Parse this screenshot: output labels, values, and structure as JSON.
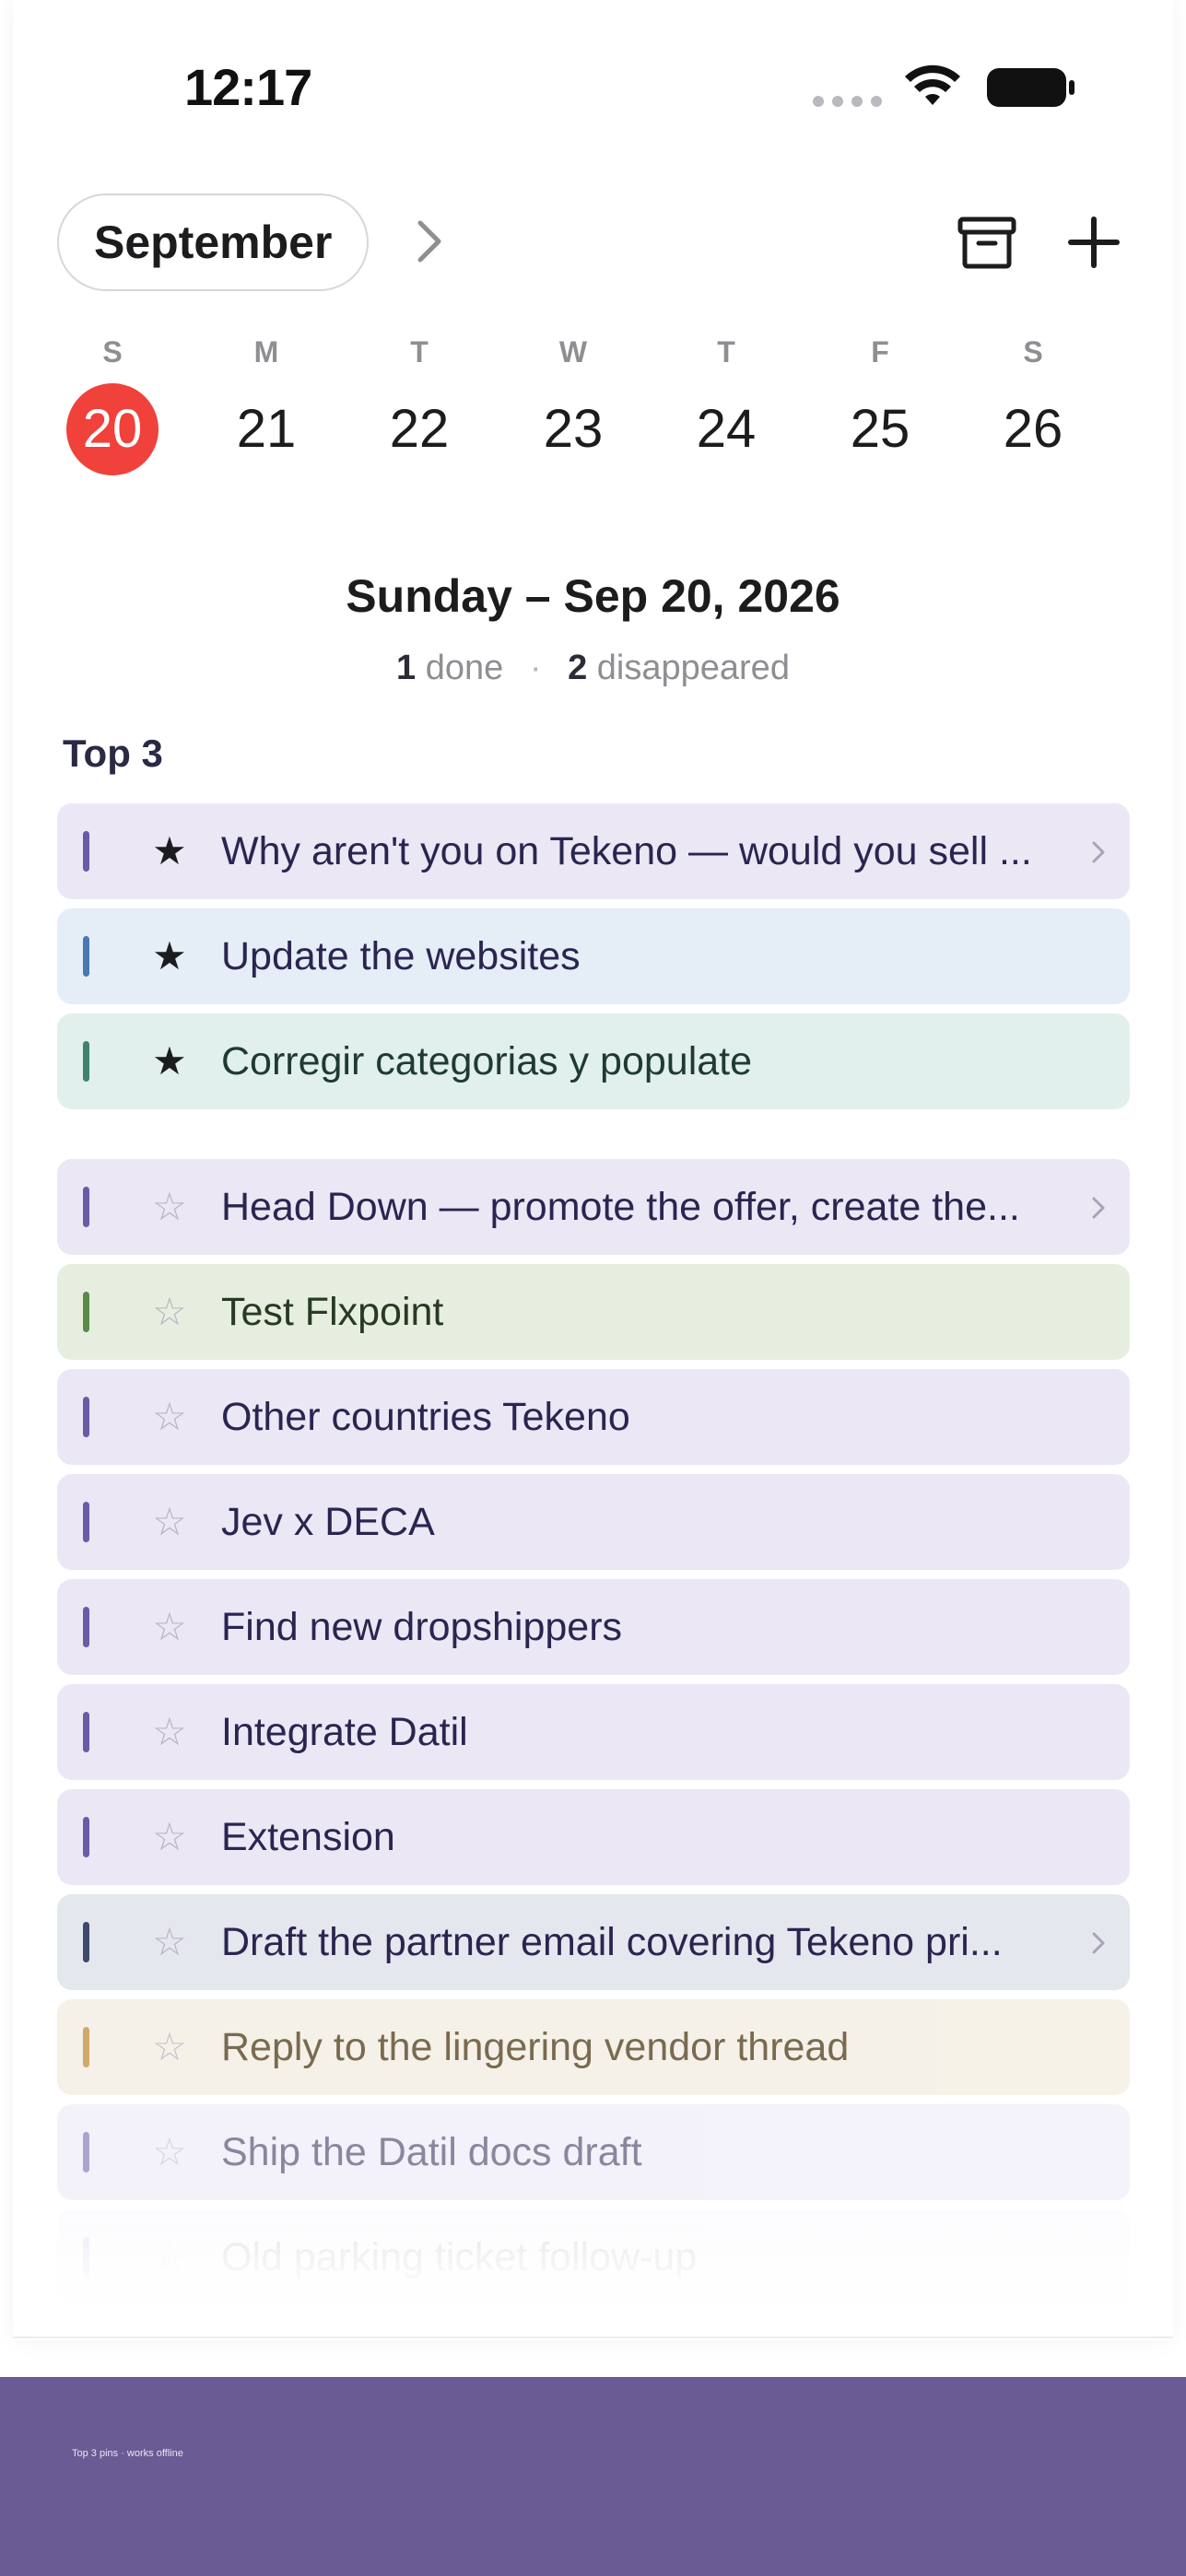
{
  "status_bar": {
    "time": "12:17"
  },
  "header": {
    "month": "September"
  },
  "week": [
    {
      "dow": "S",
      "day": "20",
      "selected": true
    },
    {
      "dow": "M",
      "day": "21"
    },
    {
      "dow": "T",
      "day": "22"
    },
    {
      "dow": "W",
      "day": "23"
    },
    {
      "dow": "T",
      "day": "24"
    },
    {
      "dow": "F",
      "day": "25"
    },
    {
      "dow": "S",
      "day": "26"
    }
  ],
  "summary": {
    "date_title": "Sunday – Sep 20, 2026",
    "done_count": "1",
    "done_label": "done",
    "separator": "·",
    "disappeared_count": "2",
    "disappeared_label": "disappeared"
  },
  "top3": {
    "title": "Top 3",
    "tasks": [
      {
        "title": "Why aren't you on Tekeno — would you sell ...",
        "color": "#6b5aa6",
        "bg": "#ebe7f5",
        "starred": true,
        "has_chevron": true
      },
      {
        "title": "Update the websites",
        "color": "#4a78b0",
        "bg": "#e5edf7",
        "starred": true
      },
      {
        "title": "Corregir categorias y populate",
        "color": "#3e8270",
        "bg": "#e1f0ec",
        "starred": true
      }
    ]
  },
  "tasks": [
    {
      "title": "Head Down — promote the offer, create the...",
      "color": "#6b5aa6",
      "bg": "#ebe7f5",
      "has_chevron": true,
      "opacity": 1
    },
    {
      "title": "Test Flxpoint",
      "color": "#5a8a4a",
      "bg": "#e6efdf",
      "opacity": 1
    },
    {
      "title": "Other countries Tekeno",
      "color": "#6b5aa6",
      "bg": "#ebe7f5",
      "opacity": 1
    },
    {
      "title": "Jev x DECA",
      "color": "#6b5aa6",
      "bg": "#ebe7f5",
      "opacity": 1
    },
    {
      "title": "Find new dropshippers",
      "color": "#6b5aa6",
      "bg": "#ebe7f5",
      "opacity": 1
    },
    {
      "title": "Integrate Datil",
      "color": "#6b5aa6",
      "bg": "#ebe7f5",
      "opacity": 1
    },
    {
      "title": "Extension",
      "color": "#6b5aa6",
      "bg": "#ebe7f5",
      "opacity": 1
    },
    {
      "title": "Draft the partner email covering Tekeno pri...",
      "color": "#3d4a6a",
      "bg": "#e4e7ee",
      "has_chevron": true,
      "opacity": 1
    },
    {
      "title": "Reply to the lingering vendor thread",
      "color": "#c8954a",
      "bg": "#f4efe3",
      "opacity": 0.82
    },
    {
      "title": "Ship the Datil docs draft",
      "color": "#6b5aa6",
      "bg": "#ebe7f5",
      "opacity": 0.55
    },
    {
      "title": "Old parking ticket follow-up",
      "color": "#6b5aa6",
      "bg": "#ebe7f5",
      "opacity": 0.15
    }
  ],
  "footer": {
    "text": "Top 3 pins · works offline"
  },
  "colors": {
    "accent_red": "#f0413b",
    "banner": "#6a5b95"
  },
  "icons": [
    "wifi-icon",
    "battery-icon",
    "chevron-right-icon",
    "archive-icon",
    "plus-icon",
    "star-filled-icon",
    "star-outline-icon"
  ]
}
